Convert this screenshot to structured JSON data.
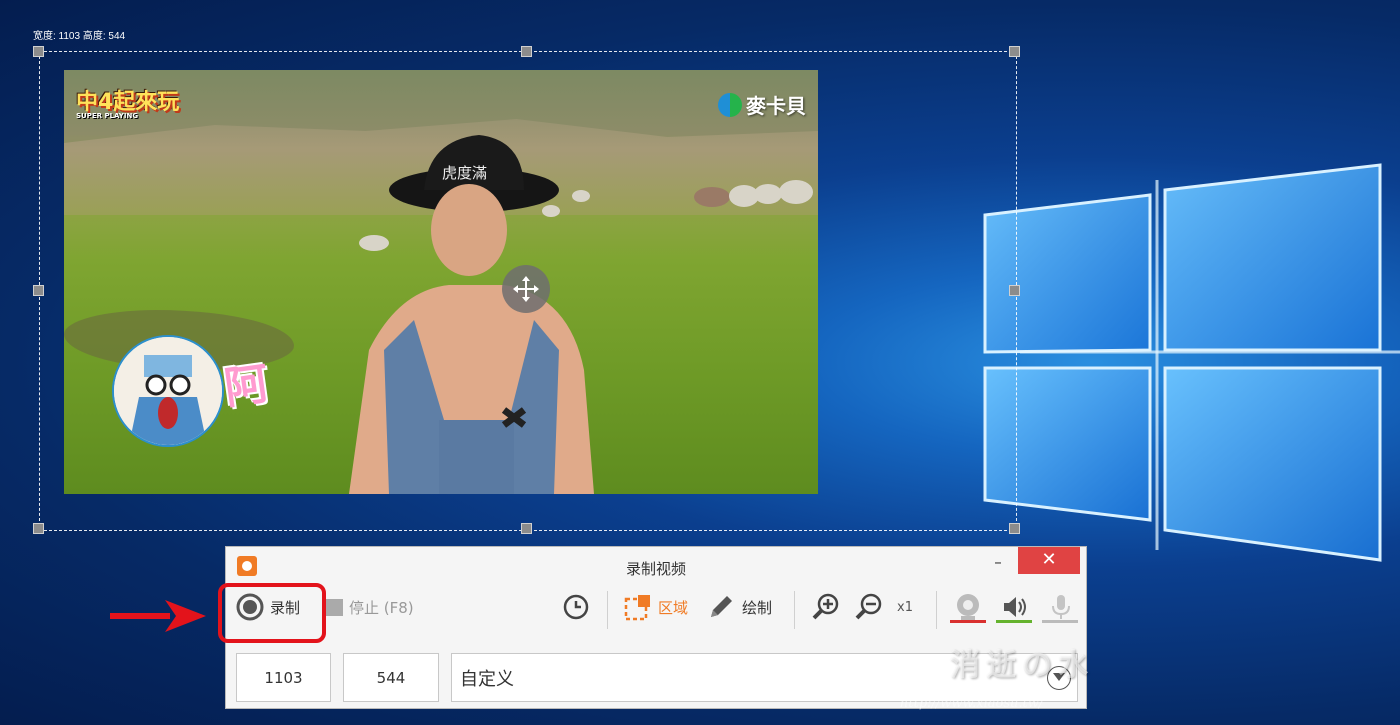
{
  "selection": {
    "dims_label": "宽度: 1103 高度: 544"
  },
  "video": {
    "show_logo": "中4起來玩",
    "show_logo_sub": "SUPER PLAYING",
    "channel_logo": "麥卡貝",
    "hat_text": "虎度滿",
    "sticker_text": "阿"
  },
  "app": {
    "title": "录制视频",
    "minimize_label": "–",
    "close_label": "✕",
    "toolbar": {
      "record_label": "录制",
      "stop_label": "停止 (F8)",
      "region_label": "区域",
      "draw_label": "绘制",
      "zoom_level": "x1"
    },
    "width_value": "1103",
    "height_value": "544",
    "preset_value": "自定义"
  },
  "watermark": {
    "text": "消逝の水",
    "url": "http://www.xiaosu.tw/"
  },
  "colors": {
    "accent": "#f07b25",
    "record_highlight": "#e3131b",
    "close_button": "#e04343"
  }
}
